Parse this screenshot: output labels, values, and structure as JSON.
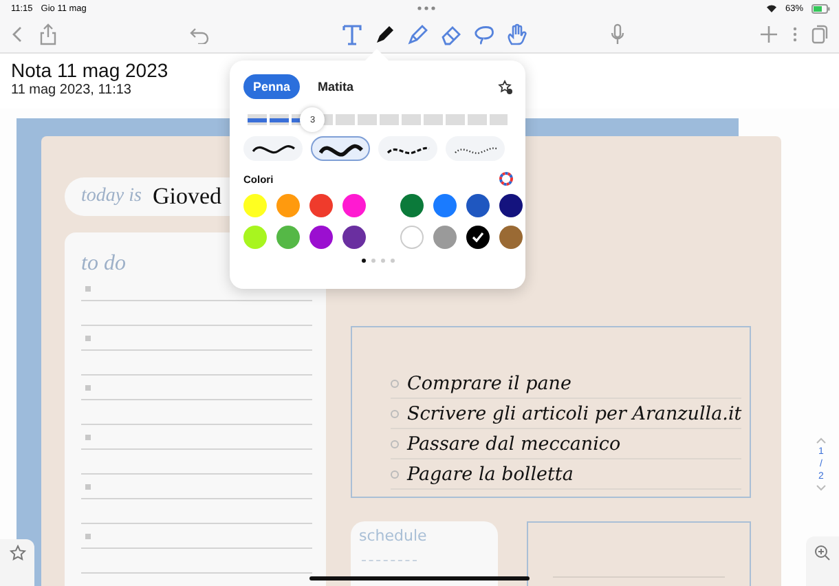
{
  "status_bar": {
    "time": "11:15",
    "date": "Gio 11 mag",
    "battery": "63%"
  },
  "toolbar": {
    "tools": [
      {
        "kind": "text",
        "selected": false
      },
      {
        "kind": "pen",
        "selected": true
      },
      {
        "kind": "highlighter",
        "selected": false
      },
      {
        "kind": "eraser",
        "selected": false
      },
      {
        "kind": "lasso",
        "selected": false
      },
      {
        "kind": "hand",
        "selected": false
      }
    ]
  },
  "note": {
    "title": "Nota 11 mag 2023",
    "subtitle": "11 mag 2023, 11:13"
  },
  "planner": {
    "today_label": "today is",
    "day": "Gioved",
    "todo_heading": "to do",
    "list": [
      "Comprare il pane",
      "Scrivere gli articoli per Aranzulla.it",
      "Passare dal meccanico",
      "Pagare la bolletta"
    ],
    "schedule_heading": "schedule"
  },
  "pen_popover": {
    "tabs": [
      {
        "label": "Penna",
        "selected": true
      },
      {
        "label": "Matita",
        "selected": false
      }
    ],
    "thickness": {
      "reading": "3",
      "level": 0.25
    },
    "styles": [
      {
        "kind": "smooth",
        "selected": false
      },
      {
        "kind": "bold",
        "selected": true
      },
      {
        "kind": "dashed",
        "selected": false
      },
      {
        "kind": "dotted",
        "selected": false
      }
    ],
    "colors_label": "Colori",
    "colors": [
      {
        "color": "#ffff20",
        "selected": false
      },
      {
        "color": "#ff9a0e",
        "selected": false
      },
      {
        "color": "#ef3b2c",
        "selected": false
      },
      {
        "color": "#ff1ad1",
        "selected": false
      },
      {
        "color": "#0b7a3a",
        "selected": false
      },
      {
        "color": "#1a7bff",
        "selected": false
      },
      {
        "color": "#1f57c0",
        "selected": false
      },
      {
        "color": "#14137e",
        "selected": false
      },
      {
        "color": "#a8f51f",
        "selected": false
      },
      {
        "color": "#55b846",
        "selected": false
      },
      {
        "color": "#9b0fd0",
        "selected": false
      },
      {
        "color": "#6a2fa0",
        "selected": false
      },
      {
        "color": "#ffffff",
        "selected": false
      },
      {
        "color": "#9a9a9a",
        "selected": false
      },
      {
        "color": "#000000",
        "selected": true
      },
      {
        "color": "#9a6a34",
        "selected": false
      }
    ],
    "pages": [
      {
        "selected": true
      },
      {
        "selected": false
      },
      {
        "selected": false
      },
      {
        "selected": false
      }
    ]
  },
  "page_indicator": {
    "current": "1",
    "separator": "/",
    "total": "2"
  }
}
